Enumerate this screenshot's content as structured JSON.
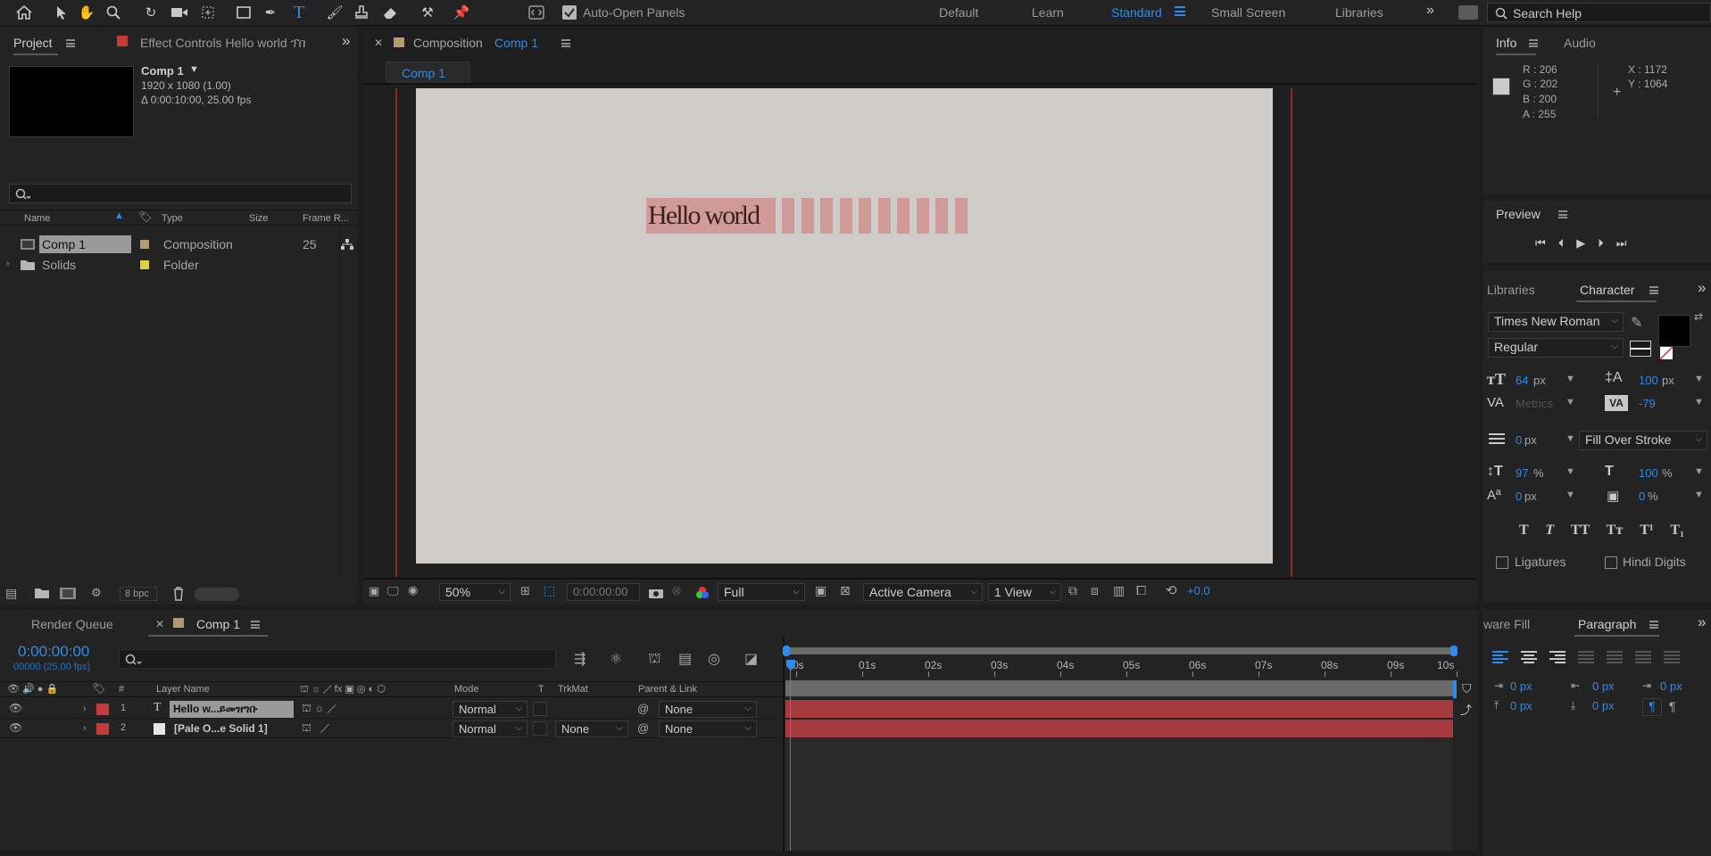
{
  "toolbar": {
    "auto_open_panels": "Auto-Open Panels",
    "workspaces": [
      "Default",
      "Learn",
      "Standard",
      "Small Screen",
      "Libraries"
    ],
    "search_placeholder": "Search Help"
  },
  "project": {
    "tab_project": "Project",
    "tab_effects": "Effect Controls Hello world ፕበ",
    "comp_name": "Comp 1",
    "comp_res": "1920 x 1080 (1.00)",
    "comp_dur": "Δ 0:00:10:00, 25.00 fps",
    "columns": {
      "name": "Name",
      "type": "Type",
      "size": "Size",
      "frame_rate": "Frame R..."
    },
    "items": [
      {
        "name": "Comp 1",
        "type": "Composition",
        "fr": "25",
        "color": "#b49a72"
      },
      {
        "name": "Solids",
        "type": "Folder",
        "fr": "",
        "color": "#e0d23d"
      }
    ],
    "bpc": "8 bpc"
  },
  "composition": {
    "tab_prefix": "Composition",
    "tab_name": "Comp 1",
    "subtab": "Comp 1",
    "canvas_text": "Hello world",
    "footer": {
      "zoom": "50%",
      "timecode": "0:00:00:00",
      "resolution": "Full",
      "camera": "Active Camera",
      "view": "1 View",
      "exposure": "+0.0"
    }
  },
  "info": {
    "tab_info": "Info",
    "tab_audio": "Audio",
    "r": "R : 206",
    "g": "G : 202",
    "b": "B : 200",
    "a": "A :  255",
    "x": "X : 1172",
    "y": "Y : 1064",
    "swatch": "#cecac8"
  },
  "preview": {
    "title": "Preview"
  },
  "character": {
    "tab_libraries": "Libraries",
    "tab_character": "Character",
    "font": "Times New Roman",
    "style": "Regular",
    "size": "64",
    "size_unit": "px",
    "leading": "100",
    "leading_unit": "px",
    "kerning": "Metrics",
    "tracking": "-79",
    "stroke": "0",
    "stroke_unit": "px",
    "stroke_mode": "Fill Over Stroke",
    "vscale": "97",
    "vscale_unit": "%",
    "hscale": "100",
    "hscale_unit": "%",
    "baseline": "0",
    "baseline_unit": "px",
    "tsume": "0",
    "tsume_unit": "%",
    "ligatures": "Ligatures",
    "hindi_digits": "Hindi Digits"
  },
  "paragraph": {
    "tab_left": "ware Fill",
    "tab_paragraph": "Paragraph",
    "indent1": "0 px",
    "indent2": "0 px",
    "indent3": "0 px",
    "space1": "0 px",
    "space2": "0 px"
  },
  "timeline": {
    "tab_render": "Render Queue",
    "tab_comp": "Comp 1",
    "timecode": "0:00:00:00",
    "frames": "00000 (25.00 fps)",
    "columns": {
      "layer_name": "Layer Name",
      "mode": "Mode",
      "t": "T",
      "trkmat": "TrkMat",
      "parent": "Parent & Link"
    },
    "ruler": [
      "0s",
      "01s",
      "02s",
      "03s",
      "04s",
      "05s",
      "06s",
      "07s",
      "08s",
      "09s",
      "10s"
    ],
    "layers": [
      {
        "num": "1",
        "name": "Hello  w...ይመዝግቡ",
        "mode": "Normal",
        "trkmat": "",
        "parent": "None",
        "color": "#c63a3a"
      },
      {
        "num": "2",
        "name": "[Pale O...e Solid 1]",
        "mode": "Normal",
        "trkmat": "None",
        "parent": "None",
        "color": "#c63a3a"
      }
    ]
  }
}
